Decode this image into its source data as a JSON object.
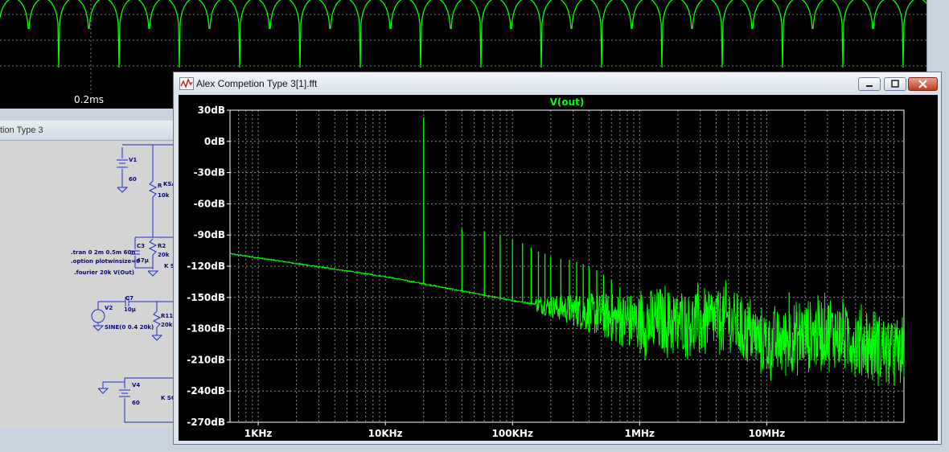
{
  "background_waveform": {
    "time_label": "0.2ms",
    "trace_color": "#00ff00"
  },
  "schematic_window": {
    "title": "tion Type 3",
    "labels": {
      "v1": "V1",
      "v1_value": "60",
      "r_top": "R",
      "r_top_value": "10k",
      "k_top": "KSA",
      "c3": "C3",
      "c3_value": "47µ",
      "r2": "R2",
      "r2_value": "20k",
      "k_mid": "K S",
      "tran": ".tran 0 2m 0.5m 60n",
      "option": ".option plotwinsize=0",
      "fourier": ".fourier 20k V(Out)",
      "c7": "C7",
      "c7_value": "10µ",
      "v2": "V2",
      "sine": "SINE(0 0.4 20k)",
      "r11": "R11",
      "r11_value": "20k",
      "v4": "V4",
      "v4_value": "60",
      "k_bot": "K SC"
    }
  },
  "fft_window": {
    "title": "Alex Competion Type 3[1].fft",
    "icon": "waveform-app-icon",
    "buttons": {
      "minimize": "minimize-icon",
      "maximize": "maximize-icon",
      "close": "close-icon"
    }
  },
  "chart_data": {
    "type": "line",
    "title": "V(out)",
    "x_scale": "log",
    "xlim_hz": [
      600,
      120000000
    ],
    "ylim_db": [
      -270,
      30
    ],
    "x_ticks": [
      {
        "value": 1000,
        "label": "1KHz"
      },
      {
        "value": 10000,
        "label": "10KHz"
      },
      {
        "value": 100000,
        "label": "100KHz"
      },
      {
        "value": 1000000,
        "label": "1MHz"
      },
      {
        "value": 10000000,
        "label": "10MHz"
      }
    ],
    "y_ticks": [
      {
        "value": 30,
        "label": "30dB"
      },
      {
        "value": 0,
        "label": "0dB"
      },
      {
        "value": -30,
        "label": "-30dB"
      },
      {
        "value": -60,
        "label": "-60dB"
      },
      {
        "value": -90,
        "label": "-90dB"
      },
      {
        "value": -120,
        "label": "-120dB"
      },
      {
        "value": -150,
        "label": "-150dB"
      },
      {
        "value": -180,
        "label": "-180dB"
      },
      {
        "value": -210,
        "label": "-210dB"
      },
      {
        "value": -240,
        "label": "-240dB"
      },
      {
        "value": -270,
        "label": "-270dB"
      }
    ],
    "grid": true,
    "series_color": "#00ff00",
    "series": [
      {
        "name": "V(out)",
        "noise_floor": [
          {
            "hz": 600,
            "db": -108
          },
          {
            "hz": 10000,
            "db": -130
          },
          {
            "hz": 100000,
            "db": -153
          },
          {
            "hz": 300000,
            "db": -162
          },
          {
            "hz": 1000000,
            "db": -175
          },
          {
            "hz": 5000000,
            "db": -172
          },
          {
            "hz": 10000000,
            "db": -195
          },
          {
            "hz": 30000000,
            "db": -182
          },
          {
            "hz": 120000000,
            "db": -205
          }
        ],
        "harmonics": [
          {
            "hz": 20000,
            "db": 23
          },
          {
            "hz": 40000,
            "db": -84
          },
          {
            "hz": 60000,
            "db": -87
          },
          {
            "hz": 80000,
            "db": -91
          },
          {
            "hz": 100000,
            "db": -94
          },
          {
            "hz": 120000,
            "db": -98
          },
          {
            "hz": 140000,
            "db": -102
          },
          {
            "hz": 160000,
            "db": -106
          },
          {
            "hz": 180000,
            "db": -108
          },
          {
            "hz": 200000,
            "db": -111
          },
          {
            "hz": 240000,
            "db": -113
          },
          {
            "hz": 280000,
            "db": -114
          },
          {
            "hz": 320000,
            "db": -116
          },
          {
            "hz": 360000,
            "db": -118
          },
          {
            "hz": 400000,
            "db": -120
          },
          {
            "hz": 460000,
            "db": -124
          },
          {
            "hz": 520000,
            "db": -128
          },
          {
            "hz": 600000,
            "db": -133
          },
          {
            "hz": 700000,
            "db": -140
          },
          {
            "hz": 800000,
            "db": -148
          },
          {
            "hz": 15000000,
            "db": -145
          },
          {
            "hz": 40000000,
            "db": -157
          }
        ]
      }
    ]
  }
}
